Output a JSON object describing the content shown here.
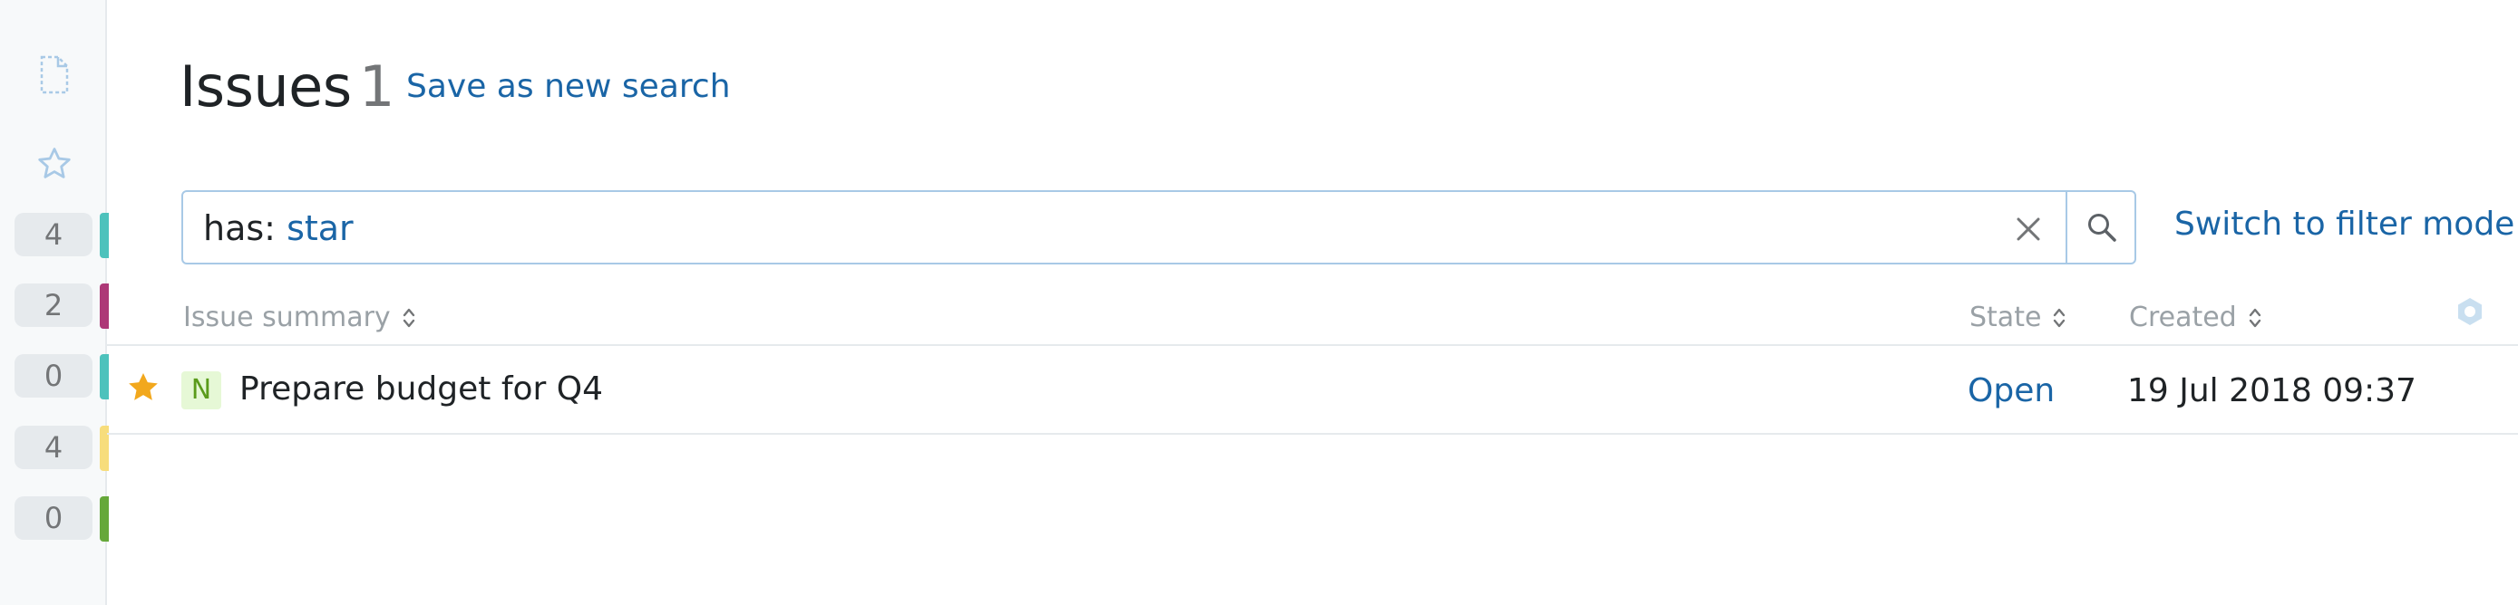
{
  "sidebar": {
    "icons": [
      {
        "name": "new-issue-icon"
      },
      {
        "name": "star-icon"
      }
    ],
    "counters": [
      {
        "count": "4",
        "color": "#4dc2bc"
      },
      {
        "count": "2",
        "color": "#ad3877"
      },
      {
        "count": "0",
        "color": "#4dc2bc"
      },
      {
        "count": "4",
        "color": "#f7dd7c"
      },
      {
        "count": "0",
        "color": "#66a83a"
      }
    ]
  },
  "header": {
    "title": "Issues",
    "count": "1",
    "save_search": "Save as new search"
  },
  "search": {
    "query_key": "has:",
    "query_value": "star",
    "clear_icon": "close-icon",
    "search_icon": "search-icon",
    "filter_mode": "Switch to filter mode"
  },
  "table": {
    "columns": [
      {
        "label": "Issue summary"
      },
      {
        "label": "State"
      },
      {
        "label": "Created"
      }
    ],
    "settings_icon": "gear-icon",
    "rows": [
      {
        "starred": true,
        "priority": "N",
        "summary": "Prepare budget for Q4",
        "state": "Open",
        "created": "19 Jul 2018 09:37"
      }
    ]
  },
  "colors": {
    "accent": "#1a65a6",
    "star": "#f2a81d",
    "priority_bg": "#e6f8d6",
    "priority_fg": "#5a9b1b"
  }
}
